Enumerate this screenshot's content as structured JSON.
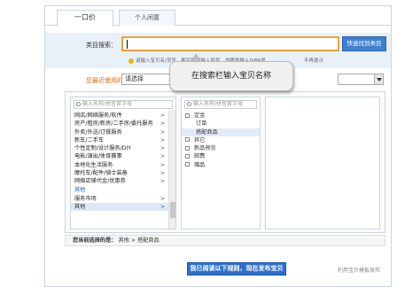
{
  "tabs": [
    {
      "label": "一口价",
      "active": true
    },
    {
      "label": "个人闲置",
      "active": false
    }
  ],
  "search": {
    "label": "类目搜索：",
    "value": "",
    "button": "快速找到类目",
    "tip": "请输入宝贝名/货号，都可能搜输入型号，书籍类输入ISBN号",
    "no_hint": "不再提示"
  },
  "callout": {
    "text": "在搜索栏输入宝贝名称"
  },
  "recent": {
    "label": "您最近使用的类目：",
    "selected": "请选择"
  },
  "pane1": {
    "placeholder": "输入名称/拼音首字母",
    "items": [
      {
        "label": "网店/网络服务/软件",
        "arrow": ">"
      },
      {
        "label": "房产/租房/新房/二手房/委托服务",
        "arrow": ">"
      },
      {
        "label": "外卖/外送/订餐服务",
        "arrow": ">"
      },
      {
        "label": "新车/二手车",
        "arrow": ">"
      },
      {
        "label": "个性定制/设计服务/DIY",
        "arrow": ">"
      },
      {
        "label": "电影/演出/体育赛事",
        "arrow": ">"
      },
      {
        "label": "本地化生活服务",
        "arrow": ">"
      },
      {
        "label": "摩托车/配件/骑士装备",
        "arrow": ">"
      },
      {
        "label": "网络店铺代金/优惠券",
        "arrow": ">"
      }
    ],
    "group_label": "其他",
    "group_items": [
      {
        "label": "服务市场",
        "arrow": ">"
      },
      {
        "label": "其他",
        "arrow": ">"
      }
    ]
  },
  "pane2": {
    "placeholder": "输入名称/拼音首字母",
    "items": [
      {
        "label": "定金",
        "box": true,
        "child": false
      },
      {
        "label": "订单",
        "box": false,
        "child": true
      },
      {
        "label": "搭配商品",
        "box": false,
        "child": true,
        "selected": true
      },
      {
        "label": "其它",
        "box": true,
        "child": false
      },
      {
        "label": "新品预览",
        "box": true,
        "child": false
      },
      {
        "label": "邮费",
        "box": true,
        "child": false
      },
      {
        "label": "赠品",
        "box": true,
        "child": false
      }
    ]
  },
  "current": {
    "label": "您当前选择的是：",
    "path": "其他 > 搭配商品"
  },
  "footer": {
    "agree_button": "我已阅读以下规则，现在发布宝贝",
    "link": "利用宝贝模板发布"
  }
}
